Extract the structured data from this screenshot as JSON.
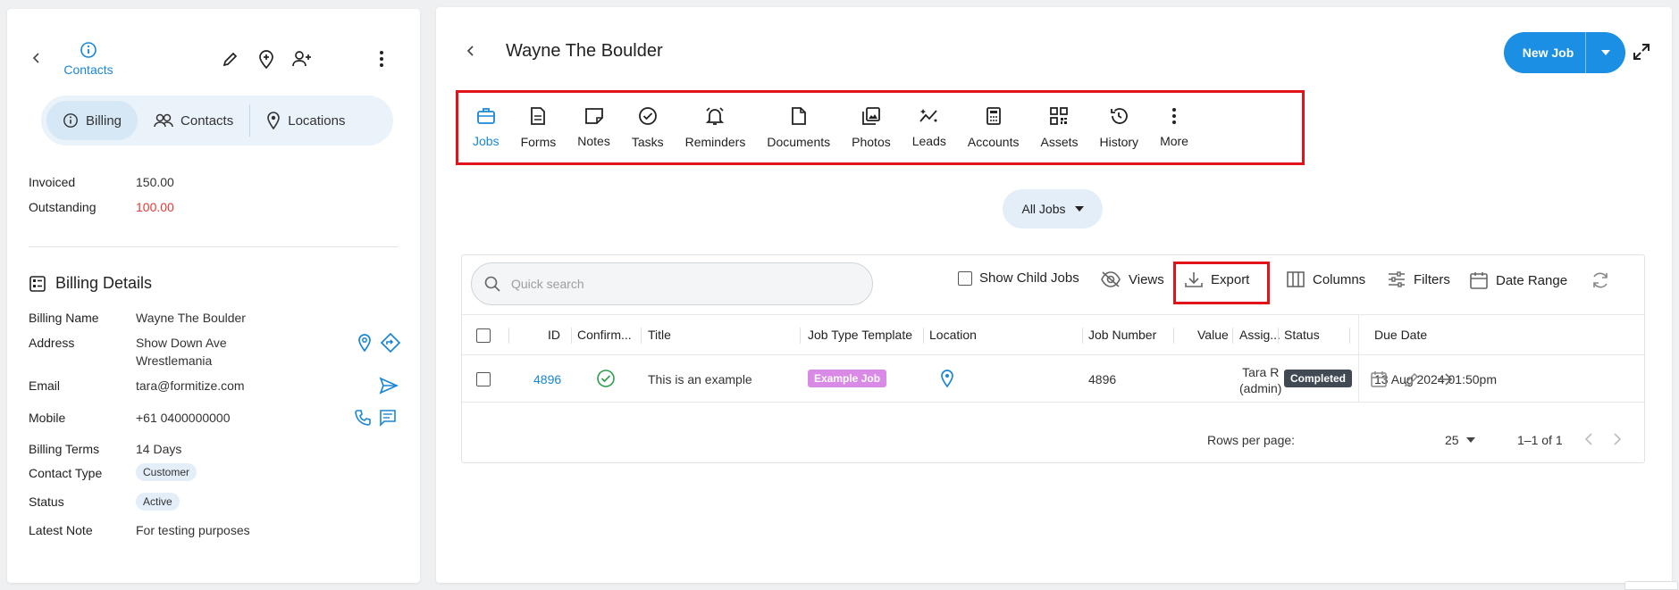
{
  "left": {
    "top_tab": "Contacts",
    "segments": [
      "Billing",
      "Contacts",
      "Locations"
    ],
    "summary": [
      {
        "label": "Invoiced",
        "value": "150.00"
      },
      {
        "label": "Outstanding",
        "value": "100.00"
      }
    ],
    "billing_details_title": "Billing Details",
    "billing_name_label": "Billing Name",
    "billing_name": "Wayne The Boulder",
    "address_label": "Address",
    "address_line1": "Show Down Ave",
    "address_line2": "Wrestlemania",
    "email_label": "Email",
    "email": "tara@formitize.com",
    "mobile_label": "Mobile",
    "mobile": "+61 0400000000",
    "terms_label": "Billing Terms",
    "terms": "14 Days",
    "contact_type_label": "Contact Type",
    "contact_type": "Customer",
    "status_label": "Status",
    "status": "Active",
    "latest_note_label": "Latest Note",
    "latest_note": "For testing purposes"
  },
  "main": {
    "title": "Wayne The Boulder",
    "new_job": "New Job",
    "nav": [
      "Jobs",
      "Forms",
      "Notes",
      "Tasks",
      "Reminders",
      "Documents",
      "Photos",
      "Leads",
      "Accounts",
      "Assets",
      "History",
      "More"
    ],
    "filter": "All Jobs",
    "search_placeholder": "Quick search",
    "toolbar": {
      "show_child": "Show Child Jobs",
      "views": "Views",
      "export": "Export",
      "columns": "Columns",
      "filters": "Filters",
      "date_range": "Date Range"
    },
    "columns": [
      "ID",
      "Confirm...",
      "Title",
      "Job Type Template",
      "Location",
      "Job Number",
      "Value",
      "Assig...",
      "Status",
      "Due Date"
    ],
    "row": {
      "id": "4896",
      "title": "This is an example",
      "template": "Example Job",
      "job_number": "4896",
      "assignee_line1": "Tara R",
      "assignee_line2": "(admin)",
      "status": "Completed",
      "due": "13 Aug 2024 01:50pm"
    },
    "pager": {
      "rows_label": "Rows per page:",
      "rows_value": "25",
      "range": "1–1 of 1"
    }
  }
}
